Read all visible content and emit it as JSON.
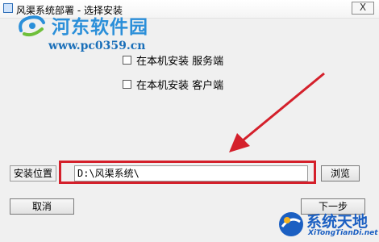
{
  "window": {
    "title": "风渠系统部署 - 选择安装",
    "close_glyph": "X"
  },
  "watermark_top": {
    "name": "河东软件园",
    "url": "www.pc0359.cn"
  },
  "options": [
    {
      "label": "在本机安装 服务端",
      "checked": false
    },
    {
      "label": "在本机安装 客户端",
      "checked": false
    }
  ],
  "install": {
    "label": "安装位置",
    "path": "D:\\风渠系统\\",
    "browse_label": "浏览"
  },
  "buttons": {
    "cancel_label": "取消",
    "next_label": "下一步"
  },
  "watermark_bottom": {
    "name": "系统天地",
    "domain": "XiTongTianDi.net"
  },
  "colors": {
    "annotation_red": "#d4202b",
    "watermark_blue": "#2b8fd9"
  }
}
